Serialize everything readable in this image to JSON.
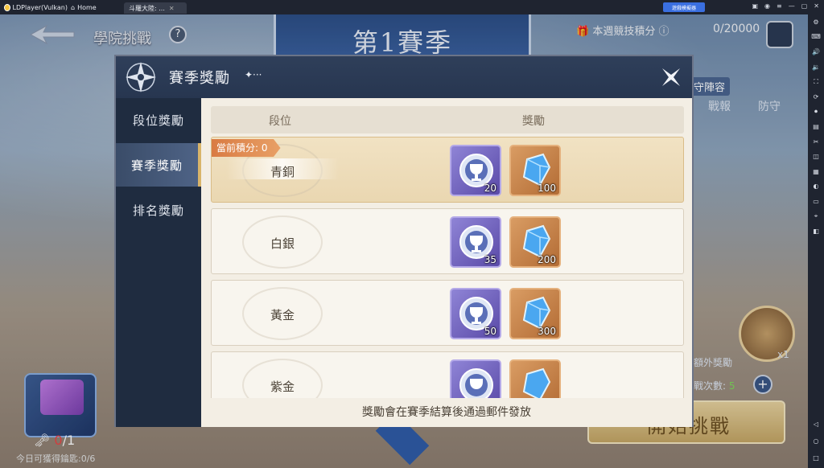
{
  "emulator": {
    "app_name": "LDPlayer(Vulkan)",
    "home_label": "Home",
    "tab_label": "斗羅大陸: ...",
    "badge_label": "遊戲模擬器"
  },
  "game": {
    "header_title": "學院挑戰",
    "season_title": "第1賽季",
    "score_label": "本週競技積分",
    "score_value": "0/20000",
    "defense_lineup": "守陣容",
    "battle_report": "戰報",
    "defense": "防守",
    "extra_reward": "額外獎勵",
    "extra_count": "x1",
    "challenge_count_label": "戰次數:",
    "challenge_count_value": "5",
    "start_button": "開始挑戰",
    "keys_value": "0",
    "keys_total": "/1",
    "keys_sub": "今日可獲得鑰匙:0/6"
  },
  "modal": {
    "title": "賽季獎勵",
    "tabs": [
      {
        "label": "段位獎勵",
        "active": false
      },
      {
        "label": "賽季獎勵",
        "active": true
      },
      {
        "label": "排名獎勵",
        "active": false
      }
    ],
    "column_tier": "段位",
    "column_reward": "獎勵",
    "current_badge": "當前積分: 0",
    "rows": [
      {
        "tier": "青銅",
        "medal": "20",
        "gem": "100",
        "current": true
      },
      {
        "tier": "白銀",
        "medal": "35",
        "gem": "200",
        "current": false
      },
      {
        "tier": "黃金",
        "medal": "50",
        "gem": "300",
        "current": false
      },
      {
        "tier": "紫金",
        "medal": "",
        "gem": "",
        "current": false
      }
    ],
    "footer": "獎勵會在賽季結算後通過郵件發放"
  }
}
